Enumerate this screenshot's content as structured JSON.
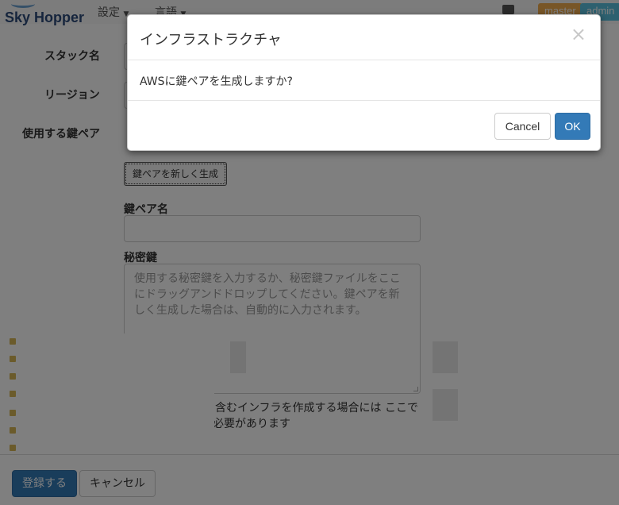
{
  "navbar": {
    "brand": "Sky Hopper",
    "menu_settings": "設定",
    "menu_language": "言語",
    "badge_master": "master",
    "badge_admin": "admin"
  },
  "form": {
    "stack_name_label": "スタック名",
    "region_label": "リージョン",
    "keypair_label": "使用する鍵ペア",
    "generate_button": "鍵ペアを新しく生成",
    "keypair_name_label": "鍵ペア名",
    "keypair_name_value": "",
    "private_key_label": "秘密鍵",
    "private_key_placeholder": "使用する秘密鍵を入力するか、秘密鍵ファイルをここにドラッグアンドドロップしてください。鍵ペアを新しく生成した場合は、自動的に入力されます。",
    "help_text": "EC2::Instance を含むインフラを作成する場合には ここで鍵ペアを設定する必要があります",
    "submit_button": "登録する",
    "cancel_button": "キャンセル"
  },
  "modal": {
    "title": "インフラストラクチャ",
    "close_symbol": "×",
    "message": "AWSに鍵ペアを生成しますか?",
    "cancel_label": "Cancel",
    "ok_label": "OK"
  },
  "colors": {
    "primary": "#337ab7",
    "badge_master": "#f0ad4e",
    "badge_admin": "#5bc0de",
    "backdrop": "rgba(0,0,0,0.5)"
  }
}
